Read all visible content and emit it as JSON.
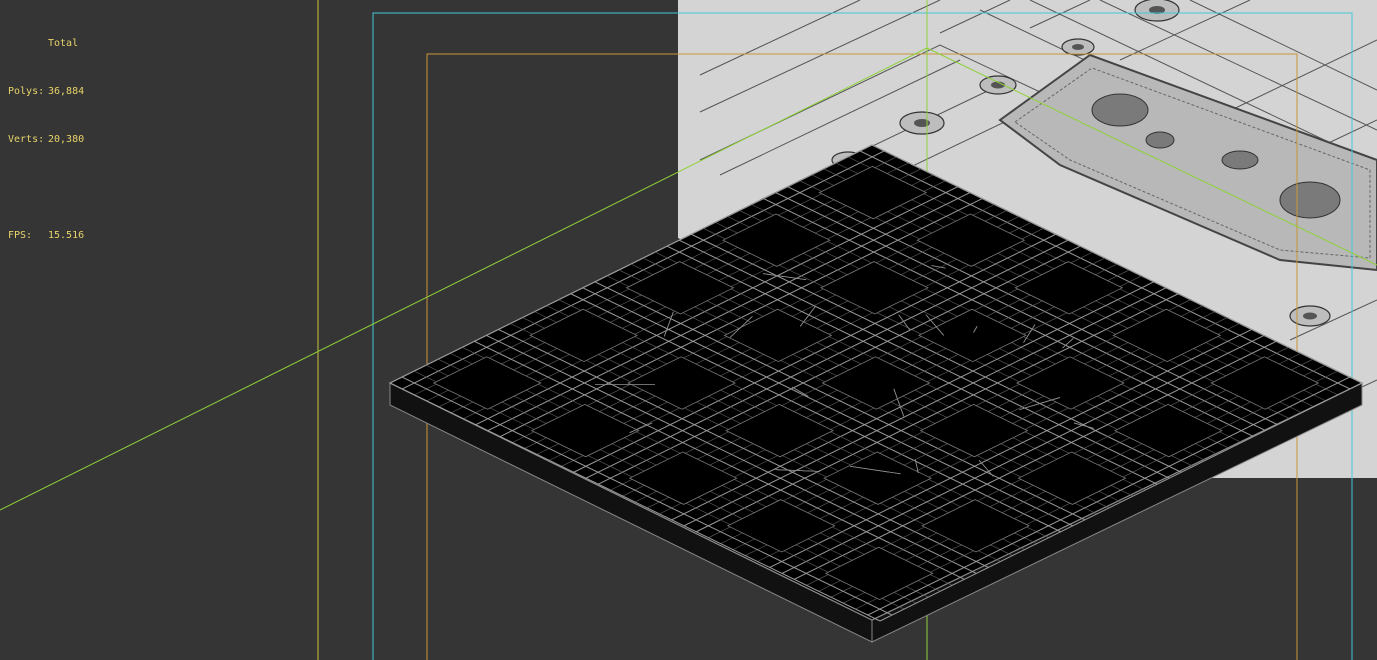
{
  "app": {
    "view": "3D viewport (wireframe over textured backdrop)"
  },
  "stats": {
    "heading": "Total",
    "polys_label": "Polys:",
    "polys_value": "36,884",
    "verts_label": "Verts:",
    "verts_value": "20,380",
    "fps_label": "FPS:",
    "fps_value": "15.516"
  },
  "colors": {
    "viewport_bg": "#353535",
    "stats_text": "#e8d36a",
    "safe_frame_cyan": "#43c7d6",
    "safe_frame_orange": "#c9953a",
    "safe_frame_yellow": "#c9c23a",
    "grid_green": "#8fd13a",
    "wireframe": "#8a8a8a",
    "mesh_fill": "#000000",
    "backdrop": "#d6d6d6"
  },
  "icons": []
}
